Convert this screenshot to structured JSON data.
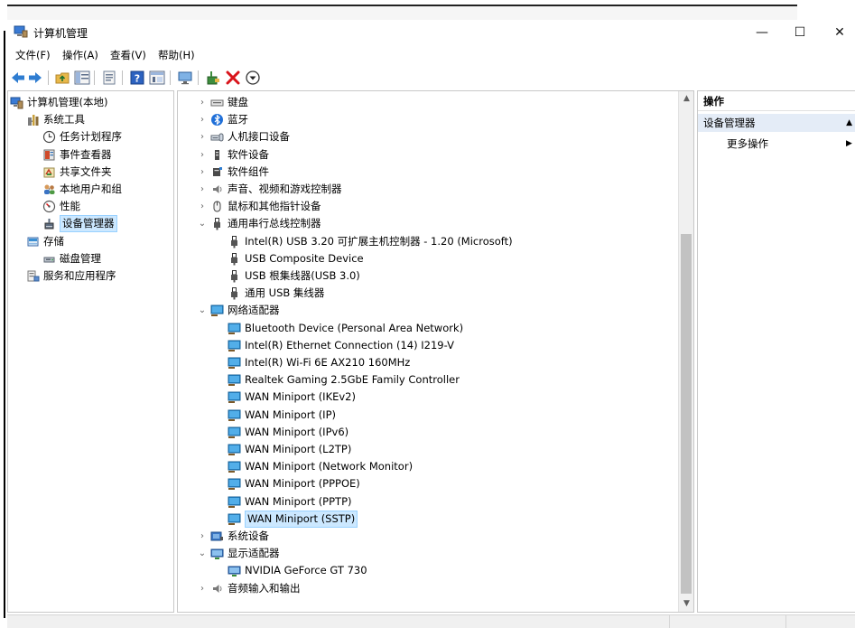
{
  "window": {
    "title": "计算机管理",
    "minimize": "—",
    "maximize": "☐",
    "close": "✕"
  },
  "menu": [
    "文件(F)",
    "操作(A)",
    "查看(V)",
    "帮助(H)"
  ],
  "left_tree": [
    {
      "label": "计算机管理(本地)",
      "indent": 0,
      "chev": "",
      "icon": "computer-management-icon"
    },
    {
      "label": "系统工具",
      "indent": 1,
      "chev": "⌄",
      "icon": "system-tools-icon"
    },
    {
      "label": "任务计划程序",
      "indent": 2,
      "chev": "›",
      "icon": "clock-icon"
    },
    {
      "label": "事件查看器",
      "indent": 2,
      "chev": "›",
      "icon": "event-viewer-icon"
    },
    {
      "label": "共享文件夹",
      "indent": 2,
      "chev": "›",
      "icon": "shared-folder-icon"
    },
    {
      "label": "本地用户和组",
      "indent": 2,
      "chev": "›",
      "icon": "users-icon"
    },
    {
      "label": "性能",
      "indent": 2,
      "chev": "›",
      "icon": "performance-icon"
    },
    {
      "label": "设备管理器",
      "indent": 2,
      "chev": "",
      "icon": "device-manager-icon",
      "selected": true
    },
    {
      "label": "存储",
      "indent": 1,
      "chev": "⌄",
      "icon": "storage-icon"
    },
    {
      "label": "磁盘管理",
      "indent": 2,
      "chev": "",
      "icon": "disk-icon"
    },
    {
      "label": "服务和应用程序",
      "indent": 1,
      "chev": "›",
      "icon": "services-icon"
    }
  ],
  "device_tree": [
    {
      "label": "键盘",
      "indent": 0,
      "chev": "›",
      "icon": "keyboard-icon"
    },
    {
      "label": "蓝牙",
      "indent": 0,
      "chev": "›",
      "icon": "bluetooth-icon"
    },
    {
      "label": "人机接口设备",
      "indent": 0,
      "chev": "›",
      "icon": "hid-icon"
    },
    {
      "label": "软件设备",
      "indent": 0,
      "chev": "›",
      "icon": "software-device-icon"
    },
    {
      "label": "软件组件",
      "indent": 0,
      "chev": "›",
      "icon": "software-component-icon"
    },
    {
      "label": "声音、视频和游戏控制器",
      "indent": 0,
      "chev": "›",
      "icon": "speaker-icon"
    },
    {
      "label": "鼠标和其他指针设备",
      "indent": 0,
      "chev": "›",
      "icon": "mouse-icon"
    },
    {
      "label": "通用串行总线控制器",
      "indent": 0,
      "chev": "⌄",
      "icon": "usb-icon"
    },
    {
      "label": "Intel(R) USB 3.20 可扩展主机控制器 - 1.20 (Microsoft)",
      "indent": 1,
      "chev": "",
      "icon": "usb-icon"
    },
    {
      "label": "USB Composite Device",
      "indent": 1,
      "chev": "",
      "icon": "usb-icon"
    },
    {
      "label": "USB 根集线器(USB 3.0)",
      "indent": 1,
      "chev": "",
      "icon": "usb-icon"
    },
    {
      "label": "通用 USB 集线器",
      "indent": 1,
      "chev": "",
      "icon": "usb-icon"
    },
    {
      "label": "网络适配器",
      "indent": 0,
      "chev": "⌄",
      "icon": "network-adapter-icon"
    },
    {
      "label": "Bluetooth Device (Personal Area Network)",
      "indent": 1,
      "chev": "",
      "icon": "network-adapter-icon"
    },
    {
      "label": "Intel(R) Ethernet Connection (14) I219-V",
      "indent": 1,
      "chev": "",
      "icon": "network-adapter-icon"
    },
    {
      "label": "Intel(R) Wi-Fi 6E AX210 160MHz",
      "indent": 1,
      "chev": "",
      "icon": "network-adapter-icon"
    },
    {
      "label": "Realtek Gaming 2.5GbE Family Controller",
      "indent": 1,
      "chev": "",
      "icon": "network-adapter-icon"
    },
    {
      "label": "WAN Miniport (IKEv2)",
      "indent": 1,
      "chev": "",
      "icon": "network-adapter-icon"
    },
    {
      "label": "WAN Miniport (IP)",
      "indent": 1,
      "chev": "",
      "icon": "network-adapter-icon"
    },
    {
      "label": "WAN Miniport (IPv6)",
      "indent": 1,
      "chev": "",
      "icon": "network-adapter-icon"
    },
    {
      "label": "WAN Miniport (L2TP)",
      "indent": 1,
      "chev": "",
      "icon": "network-adapter-icon"
    },
    {
      "label": "WAN Miniport (Network Monitor)",
      "indent": 1,
      "chev": "",
      "icon": "network-adapter-icon"
    },
    {
      "label": "WAN Miniport (PPPOE)",
      "indent": 1,
      "chev": "",
      "icon": "network-adapter-icon"
    },
    {
      "label": "WAN Miniport (PPTP)",
      "indent": 1,
      "chev": "",
      "icon": "network-adapter-icon"
    },
    {
      "label": "WAN Miniport (SSTP)",
      "indent": 1,
      "chev": "",
      "icon": "network-adapter-icon",
      "selected": true
    },
    {
      "label": "系统设备",
      "indent": 0,
      "chev": "›",
      "icon": "system-device-icon"
    },
    {
      "label": "显示适配器",
      "indent": 0,
      "chev": "⌄",
      "icon": "display-adapter-icon"
    },
    {
      "label": "NVIDIA GeForce GT 730",
      "indent": 1,
      "chev": "",
      "icon": "display-adapter-icon"
    },
    {
      "label": "音频输入和输出",
      "indent": 0,
      "chev": "›",
      "icon": "speaker-icon"
    }
  ],
  "scroll": {
    "up": "▲",
    "down": "▼"
  },
  "actions": {
    "header": "操作",
    "section": "设备管理器",
    "section_arrow": "▲",
    "more": "更多操作",
    "more_arrow": "▶"
  },
  "colors": {
    "selection": "#cce8ff",
    "network_icon": "#2a8fd4",
    "close_red": "#e81123",
    "action_bar": "#e4ecf7"
  }
}
